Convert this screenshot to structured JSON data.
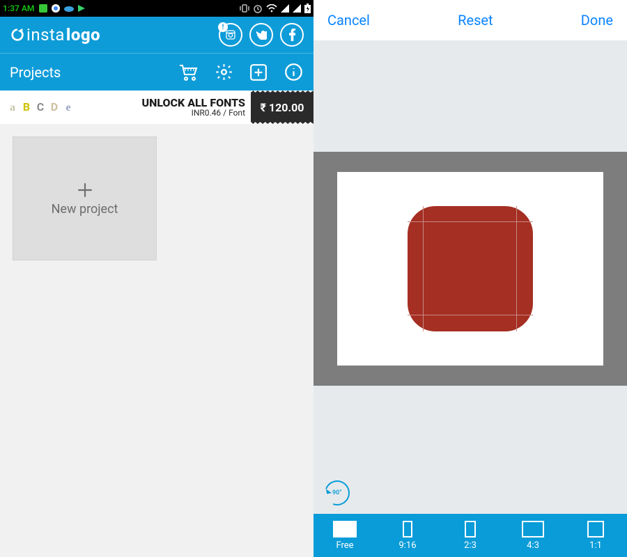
{
  "statusbar": {
    "time": "1:37 AM"
  },
  "brand": {
    "name_a": "insta",
    "name_b": "logo"
  },
  "toolbar": {
    "title": "Projects"
  },
  "promo": {
    "letters": [
      "a",
      "B",
      "C",
      "D",
      "e"
    ],
    "line1": "UNLOCK ALL FONTS",
    "line2": "INR0.46 / Font",
    "price": "₹ 120.00"
  },
  "project": {
    "new_label": "New project"
  },
  "editor": {
    "cancel": "Cancel",
    "reset": "Reset",
    "done": "Done",
    "rotate_label": "90°",
    "aspects": [
      {
        "label": "Free",
        "shape": "sh-free",
        "selected": true
      },
      {
        "label": "9:16",
        "shape": "sh-916",
        "selected": false
      },
      {
        "label": "2:3",
        "shape": "sh-23",
        "selected": false
      },
      {
        "label": "4:3",
        "shape": "sh-43",
        "selected": false
      },
      {
        "label": "1:1",
        "shape": "sh-11",
        "selected": false
      }
    ]
  }
}
